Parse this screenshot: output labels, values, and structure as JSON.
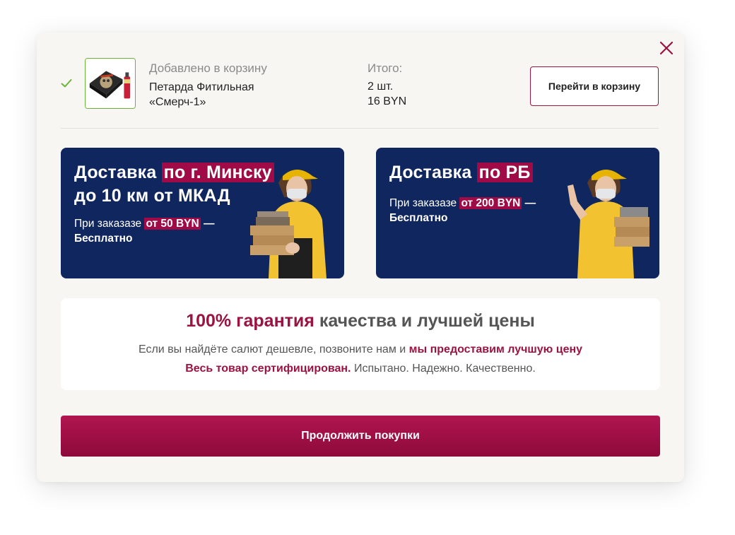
{
  "cart_notice": {
    "added_label": "Добавлено в корзину",
    "product_name": "Петарда Фитильная «Смерч-1»",
    "total_label": "Итого:",
    "total_qty": "2 шт.",
    "total_sum": "16 BYN",
    "go_to_cart": "Перейти в корзину"
  },
  "banners": [
    {
      "title_pre": "Доставка ",
      "title_hl": "по г. Минску",
      "title_post": " до 10 км от МКАД",
      "sub_pre": "При заказазе ",
      "sub_hl": "от 50 BYN",
      "sub_post": " — Бесплатно"
    },
    {
      "title_pre": "Доставка ",
      "title_hl": "по РБ",
      "title_post": "",
      "sub_pre": "При заказазе ",
      "sub_hl": "от 200 BYN",
      "sub_post": " — Бесплатно"
    }
  ],
  "guarantee": {
    "title_accent": "100% гарантия",
    "title_rest": " качества и лучшей цены",
    "line1_pre": "Если вы найдёте салют дешевле, позвоните нам и ",
    "line1_accent": "мы предоставим лучшую цену",
    "line2_accent": "Весь товар сертифицирован.",
    "line2_rest": " Испытано. Надежно. Качественно."
  },
  "continue_label": "Продолжить покупки",
  "colors": {
    "accent": "#9b1341",
    "banner_bg": "#10265e",
    "check": "#6bb33a",
    "modal_bg": "#f7f6f2"
  },
  "icons": {
    "close": "close-icon",
    "check": "check-icon"
  }
}
